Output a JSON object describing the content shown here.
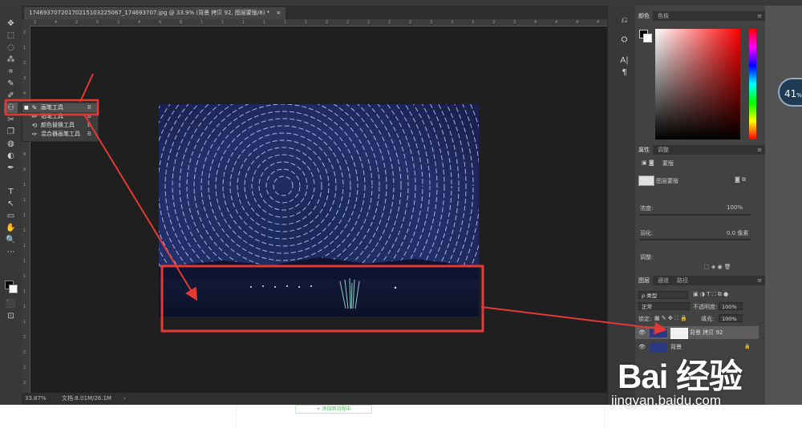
{
  "document": {
    "tab_title": "174693707201702151032250​67_174693707.jpg @ 33.9% (背景 拷贝 92, 图层蒙版/8) *",
    "tab_close": "×",
    "status_zoom": "33.87%",
    "status_doc": "文档:8.01M/26.1M",
    "status_arrow": "›"
  },
  "ruler": {
    "top_ticks": [
      "2",
      "4",
      "2",
      "0",
      "2",
      "4",
      "6",
      "8",
      "1",
      "1",
      "1",
      "1",
      "1",
      "1",
      "2",
      "2",
      "2",
      "2",
      "2",
      "3",
      "3",
      "3",
      "3",
      "3",
      "4",
      "4",
      "4",
      "4"
    ],
    "left_ticks": [
      "2",
      "1",
      "2",
      "3",
      "4",
      "5",
      "6",
      "7",
      "8",
      "9",
      "1",
      "1",
      "1",
      "1",
      "1",
      "1",
      "1",
      "1",
      "1",
      "1",
      "2",
      "2",
      "2",
      "2"
    ]
  },
  "toolbar": {
    "tools": [
      "✥",
      "⬚",
      "◌",
      "⁂",
      "⌗",
      "✎",
      "✐",
      "⚇",
      "✂",
      "❐",
      "◍",
      "◐",
      "✒",
      "T",
      "↖",
      "▭",
      "✋",
      "🔍",
      "⋯",
      "◧",
      "⬛",
      "⊡",
      "⊟"
    ]
  },
  "flyout": {
    "items": [
      {
        "icon": "✎",
        "label": "画笔工具",
        "shortcut": "B",
        "selected": true
      },
      {
        "icon": "✏",
        "label": "铅笔工具",
        "shortcut": "B",
        "selected": false
      },
      {
        "icon": "⟲",
        "label": "颜色替换工具",
        "shortcut": "B",
        "selected": false
      },
      {
        "icon": "✑",
        "label": "混合器画笔工具",
        "shortcut": "B",
        "selected": false
      }
    ]
  },
  "dock_strip": {
    "icons": [
      "⎌",
      "⛭",
      "A|",
      "¶"
    ]
  },
  "color_panel": {
    "tabs": [
      "颜色",
      "色板"
    ],
    "menu": "≡"
  },
  "properties_panel": {
    "tabs": [
      "属性",
      "调整"
    ],
    "menu": "≡",
    "mask_label": "蒙版",
    "layer_mask_label": "图层蒙版",
    "density_label": "浓度:",
    "density_value": "100%",
    "feather_label": "羽化:",
    "feather_value": "0.0 像素",
    "adjust_label": "调整:"
  },
  "layers_panel": {
    "tabs": [
      "图层",
      "通道",
      "路径"
    ],
    "menu": "≡",
    "filter_kind": "ρ 类型",
    "blend_mode": "正常",
    "opacity_label": "不透明度:",
    "opacity_value": "100%",
    "lock_label": "锁定:",
    "fill_label": "填充:",
    "fill_value": "100%",
    "layers": [
      {
        "name": "背景 拷贝 92",
        "visible": true,
        "selected": true,
        "locked": false
      },
      {
        "name": "背景",
        "visible": true,
        "selected": false,
        "locked": true
      }
    ],
    "bottom_icons": [
      "⊖",
      "fx",
      "◙",
      "◑",
      "▭",
      "▣",
      "🗑"
    ]
  },
  "bottom_page": {
    "button_label": "+ 添加到流程中"
  },
  "watermark": {
    "logo": "Bai 经验",
    "url": "jingyan.baidu.com"
  },
  "zoom_widget": {
    "value": "41",
    "unit": "%"
  },
  "colors": {
    "app_bg": "#535353",
    "panel_bg": "#424242",
    "canvas_bg": "#1f1f1f",
    "annotation_red": "#e53935"
  }
}
